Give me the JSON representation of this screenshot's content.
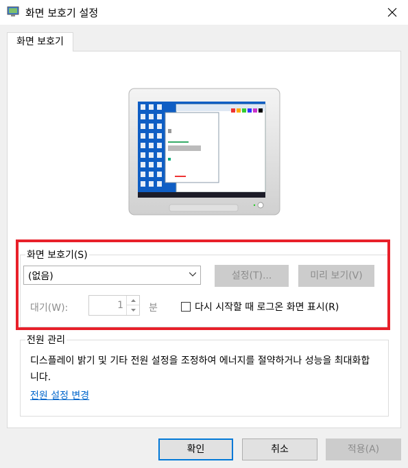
{
  "window": {
    "title": "화면 보호기 설정",
    "close_glyph": "✕"
  },
  "tab": {
    "label": "화면 보호기"
  },
  "screensaver": {
    "group_label": "화면 보호기(S)",
    "selected": "(없음)",
    "settings_button": "설정(T)...",
    "preview_button": "미리 보기(V)",
    "wait_label": "대기(W):",
    "wait_value": "1",
    "wait_unit": "분",
    "resume_checkbox_label": "다시 시작할 때 로그온 화면 표시(R)",
    "resume_checked": false
  },
  "power": {
    "group_label": "전원 관리",
    "description": "디스플레이 밝기 및 기타 전원 설정을 조정하여 에너지를 절약하거나 성능을 최대화합니다.",
    "link": "전원 설정 변경"
  },
  "footer": {
    "ok": "확인",
    "cancel": "취소",
    "apply": "적용(A)"
  },
  "colors": {
    "highlight": "#e8202a",
    "link": "#0066cc",
    "desktop": "#1a73d9"
  }
}
